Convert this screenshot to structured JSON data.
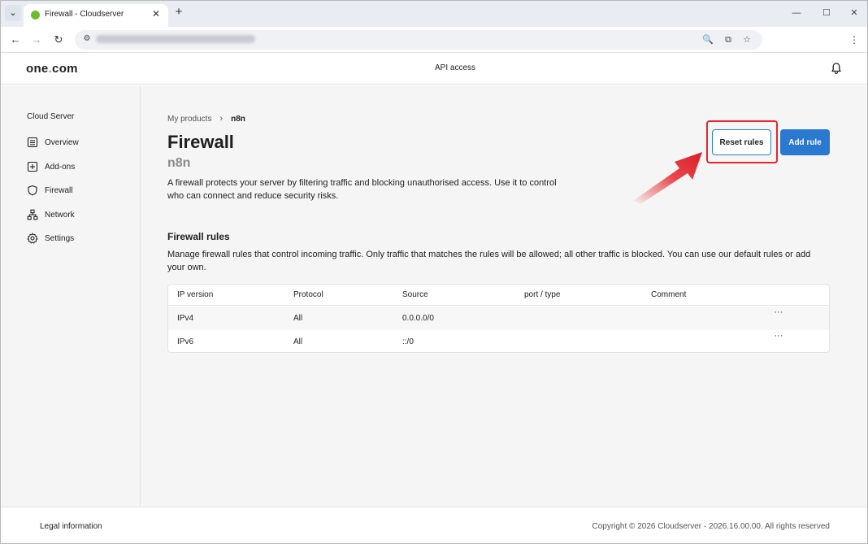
{
  "browser": {
    "tab_title": "Firewall - Cloudserver",
    "tab_close_glyph": "✕",
    "new_tab_glyph": "+",
    "tab_list_glyph": "⌄",
    "back_glyph": "←",
    "forward_glyph": "→",
    "reload_glyph": "↻",
    "minimize_glyph": "—",
    "maximize_glyph": "☐",
    "close_glyph": "✕",
    "zoom_glyph": "🔍",
    "menu_glyph": "⋮",
    "star_glyph": "☆",
    "cast_glyph": "⧉",
    "site_info_glyph": "⚙"
  },
  "header": {
    "logo_main": "one",
    "logo_dot": ".",
    "logo_end": "com",
    "api_access": "API access",
    "bell_icon": "bell-icon"
  },
  "sidebar": {
    "title": "Cloud Server",
    "items": [
      {
        "label": "Overview",
        "icon": "overview-icon"
      },
      {
        "label": "Add-ons",
        "icon": "plus-square-icon"
      },
      {
        "label": "Firewall",
        "icon": "shield-icon"
      },
      {
        "label": "Network",
        "icon": "network-icon"
      },
      {
        "label": "Settings",
        "icon": "gear-icon"
      }
    ]
  },
  "breadcrumb": {
    "parent": "My products",
    "separator": "›",
    "current": "n8n"
  },
  "page": {
    "title": "Firewall",
    "subtitle": "n8n",
    "description": "A firewall protects your server by filtering traffic and blocking unauthorised access. Use it to control who can connect and reduce security risks."
  },
  "actions": {
    "reset_label": "Reset rules",
    "add_label": "Add rule"
  },
  "rules": {
    "title": "Firewall rules",
    "description": "Manage firewall rules that control incoming traffic. Only traffic that matches the rules will be allowed; all other traffic is blocked. You can use our default rules or add your own.",
    "columns": [
      "IP version",
      "Protocol",
      "Source",
      "port / type",
      "Comment"
    ],
    "rows": [
      {
        "ip_version": "IPv4",
        "protocol": "All",
        "source": "0.0.0.0/0",
        "port_type": "",
        "comment": "",
        "menu": "···"
      },
      {
        "ip_version": "IPv6",
        "protocol": "All",
        "source": "::/0",
        "port_type": "",
        "comment": "",
        "menu": "···"
      }
    ]
  },
  "footer": {
    "legal": "Legal information",
    "copyright": "Copyright © 2026 Cloudserver - 2026.16.00.00. All rights reserved"
  },
  "colors": {
    "primary_button": "#2b78d0",
    "highlight": "#e8262d",
    "logo_dot": "#6fbd2b"
  }
}
